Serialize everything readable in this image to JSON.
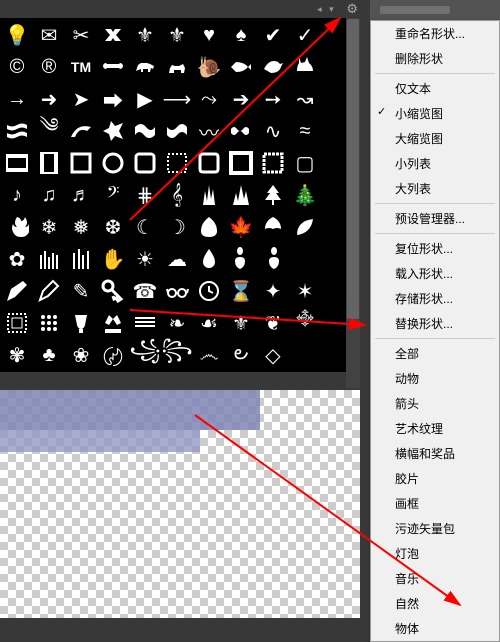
{
  "menu": {
    "rename": "重命名形状...",
    "delete": "删除形状",
    "text_only": "仅文本",
    "small_thumb": "小缩览图",
    "large_thumb": "大缩览图",
    "small_list": "小列表",
    "large_list": "大列表",
    "preset_mgr": "预设管理器...",
    "reset": "复位形状...",
    "load": "载入形状...",
    "save": "存储形状...",
    "replace": "替换形状...",
    "all": "全部",
    "animals": "动物",
    "arrows": "箭头",
    "art": "艺术纹理",
    "banners": "横幅和奖品",
    "film": "胶片",
    "frames": "画框",
    "grime": "污迹矢量包",
    "bulbs": "灯泡",
    "music": "音乐",
    "nature": "自然",
    "objects": "物体"
  },
  "selected_view": "small_thumb"
}
